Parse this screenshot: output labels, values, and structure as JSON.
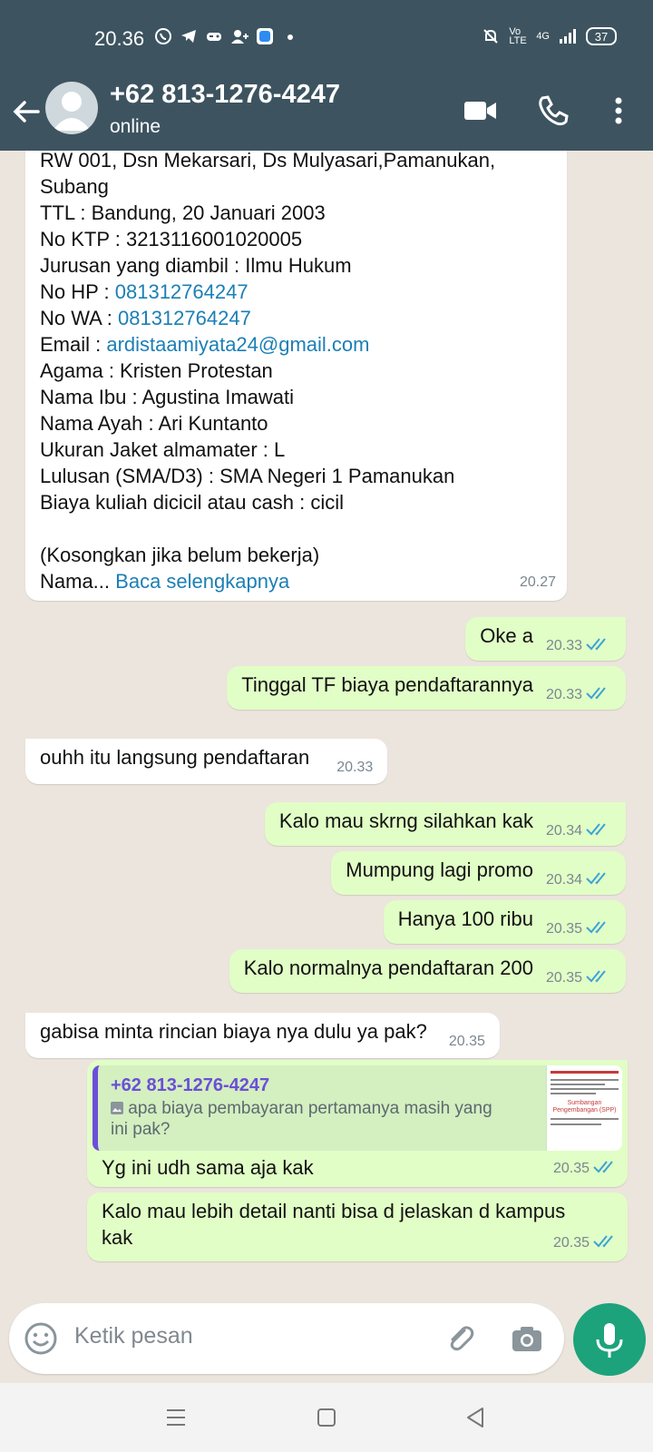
{
  "status_bar": {
    "time": "20.36",
    "volte": "Vo LTE",
    "network": "4G",
    "battery": "37"
  },
  "header": {
    "contact_name": "+62 813-1276-4247",
    "contact_status": "online"
  },
  "messages": [
    {
      "direction": "in",
      "lines": [
        "RW 001, Dsn Mekarsari, Ds Mulyasari,Pamanukan,",
        "Subang",
        "TTL : Bandung, 20 Januari 2003",
        "No KTP : 3213116001020005"
      ],
      "jurusan": "Jurusan yang diambil : Ilmu Hukum",
      "hp_label": "No HP : ",
      "hp_value": "081312764247",
      "wa_label": "No WA : ",
      "wa_value": "081312764247",
      "email_label": "Email : ",
      "email_value": "ardistaamiyata24@gmail.com",
      "lines2": [
        "Agama : Kristen Protestan",
        "Nama Ibu : Agustina Imawati",
        "Nama Ayah : Ari Kuntanto",
        "Ukuran Jaket almamater : L",
        "Lulusan (SMA/D3) : SMA Negeri 1 Pamanukan",
        "Biaya kuliah dicicil atau cash : cicil"
      ],
      "note": "(Kosongkan jika belum bekerja)",
      "truncated": "Nama...",
      "read_more": "Baca selengkapnya",
      "time": "20.27"
    },
    {
      "direction": "out",
      "text": "Oke a",
      "time": "20.33"
    },
    {
      "direction": "out",
      "text": "Tinggal TF biaya pendaftarannya",
      "time": "20.33"
    },
    {
      "direction": "in",
      "text": "ouhh itu langsung pendaftaran",
      "time": "20.33"
    },
    {
      "direction": "out",
      "text": "Kalo mau skrng silahkan kak",
      "time": "20.34"
    },
    {
      "direction": "out",
      "text": "Mumpung lagi promo",
      "time": "20.34"
    },
    {
      "direction": "out",
      "text": "Hanya 100 ribu",
      "time": "20.35"
    },
    {
      "direction": "out",
      "text": "Kalo normalnya pendaftaran 200",
      "time": "20.35"
    },
    {
      "direction": "in",
      "text": "gabisa minta rincian biaya nya dulu ya pak?",
      "time": "20.35"
    },
    {
      "direction": "out",
      "quote_author": "+62 813-1276-4247",
      "quote_text_1": "apa biaya pembayaran pertamanya masih yang",
      "quote_text_2": "ini pak?",
      "thumb_title": "Sumbangan Pengembangan (SPP)",
      "text": "Yg ini udh sama aja kak",
      "time": "20.35"
    },
    {
      "direction": "out",
      "line1": "Kalo mau lebih detail nanti bisa d jelaskan d kampus",
      "line2": "kak",
      "time": "20.35"
    }
  ],
  "input": {
    "placeholder": "Ketik pesan"
  },
  "colors": {
    "header": "#3d5460",
    "chat_bg": "#ece5dd",
    "outgoing": "#e1fec6",
    "incoming": "#ffffff",
    "link": "#1c7fb5",
    "read_ticks": "#3ba3d6",
    "mic_button": "#1ca37b"
  }
}
